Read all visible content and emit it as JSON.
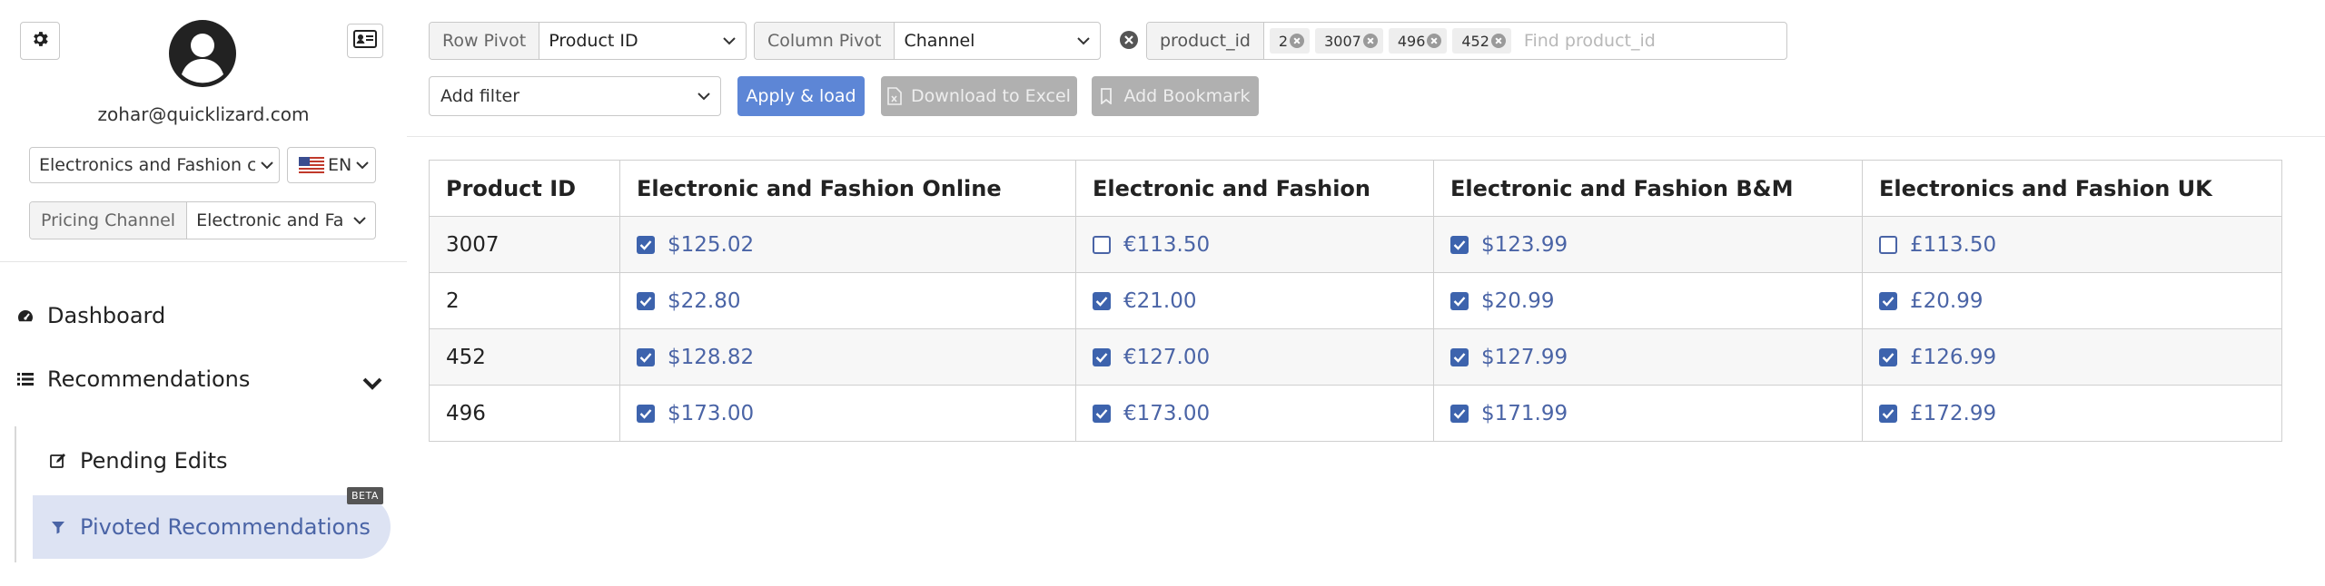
{
  "sidebar": {
    "email": "zohar@quicklizard.com",
    "org_select": "Electronics and Fashion c",
    "lang": "EN",
    "pricing_channel_label": "Pricing Channel",
    "pricing_channel_value": "Electronic and Fa",
    "nav": {
      "dashboard": "Dashboard",
      "recommendations": "Recommendations",
      "pending_edits": "Pending Edits",
      "pivoted_recommendations": "Pivoted Recommendations",
      "beta_badge": "BETA"
    }
  },
  "toolbar": {
    "row_pivot_label": "Row Pivot",
    "row_pivot_value": "Product ID",
    "column_pivot_label": "Column Pivot",
    "column_pivot_value": "Channel",
    "filter_field": "product_id",
    "filter_chips": [
      "2",
      "3007",
      "496",
      "452"
    ],
    "find_placeholder": "Find product_id",
    "add_filter": "Add filter",
    "apply_load": "Apply & load",
    "download_excel": "Download to Excel",
    "add_bookmark": "Add Bookmark"
  },
  "table": {
    "headers": [
      "Product ID",
      "Electronic and Fashion Online",
      "Electronic and Fashion",
      "Electronic and Fashion B&M",
      "Electronics and Fashion UK"
    ],
    "rows": [
      {
        "id": "3007",
        "cells": [
          {
            "checked": true,
            "price": "$125.02"
          },
          {
            "checked": false,
            "price": "€113.50"
          },
          {
            "checked": true,
            "price": "$123.99"
          },
          {
            "checked": false,
            "price": "£113.50"
          }
        ]
      },
      {
        "id": "2",
        "cells": [
          {
            "checked": true,
            "price": "$22.80"
          },
          {
            "checked": true,
            "price": "€21.00"
          },
          {
            "checked": true,
            "price": "$20.99"
          },
          {
            "checked": true,
            "price": "£20.99"
          }
        ]
      },
      {
        "id": "452",
        "cells": [
          {
            "checked": true,
            "price": "$128.82"
          },
          {
            "checked": true,
            "price": "€127.00"
          },
          {
            "checked": true,
            "price": "$127.99"
          },
          {
            "checked": true,
            "price": "£126.99"
          }
        ]
      },
      {
        "id": "496",
        "cells": [
          {
            "checked": true,
            "price": "$173.00"
          },
          {
            "checked": true,
            "price": "€173.00"
          },
          {
            "checked": true,
            "price": "$171.99"
          },
          {
            "checked": true,
            "price": "£172.99"
          }
        ]
      }
    ]
  },
  "colors": {
    "accent": "#5d86d6",
    "link": "#4a64a6",
    "checkbox": "#3d63ad",
    "active_nav_bg": "#dde3f3",
    "disabled_button": "#b0b0b0"
  },
  "icons": {
    "settings": "gear-icon",
    "profile_card": "id-card-icon",
    "avatar": "user-avatar-icon",
    "dashboard": "tachometer-icon",
    "recommendations": "list-icon",
    "pending": "edit-icon",
    "pivoted": "filter-icon",
    "clear_filter": "close-circle-icon",
    "excel": "file-excel-icon",
    "bookmark": "bookmark-icon"
  }
}
